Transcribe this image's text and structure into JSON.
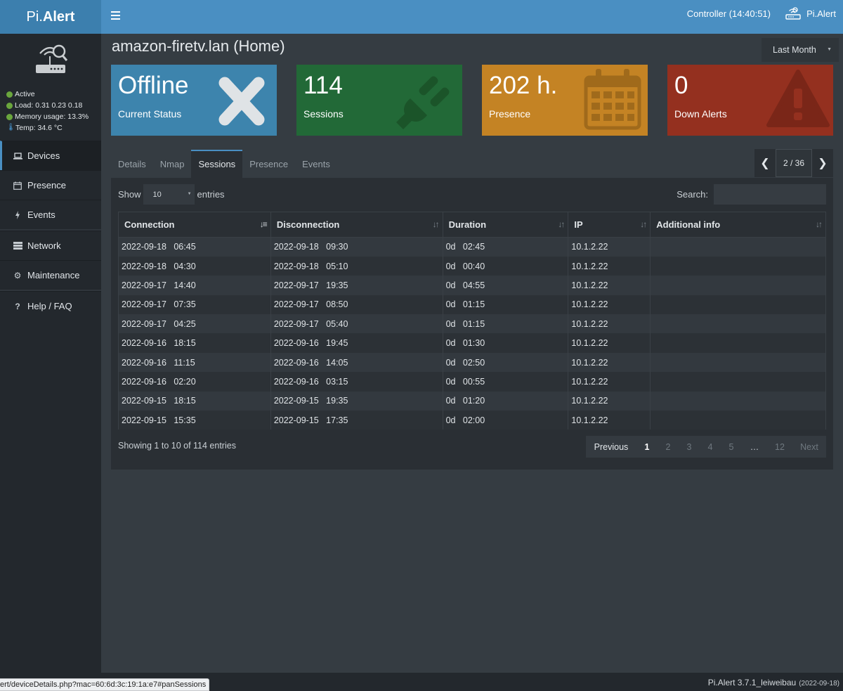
{
  "brand": {
    "light": "Pi.",
    "bold": "Alert"
  },
  "topbar": {
    "controller": "Controller (14:40:51)",
    "user": "Pi.Alert"
  },
  "sidebar": {
    "status": [
      {
        "label": "Active"
      },
      {
        "label": "Load:  0.31  0.23  0.18"
      },
      {
        "label": "Memory usage:  13.3%"
      },
      {
        "label": "Temp: 34.6 °C"
      }
    ],
    "nav": [
      {
        "label": "Devices",
        "icon": "laptop-icon"
      },
      {
        "label": "Presence",
        "icon": "calendar-icon"
      },
      {
        "label": "Events",
        "icon": "bolt-icon"
      },
      {
        "label": "Network",
        "icon": "server-icon"
      },
      {
        "label": "Maintenance",
        "icon": "gear-icon"
      },
      {
        "label": "Help / FAQ",
        "icon": "question-icon"
      }
    ]
  },
  "header": {
    "title": "amazon-firetv.lan (Home)",
    "range": "Last Month"
  },
  "boxes": [
    {
      "value": "Offline",
      "label": "Current Status",
      "icon": "close-icon",
      "color": "#3d84ad"
    },
    {
      "value": "114",
      "label": "Sessions",
      "icon": "plug-icon",
      "color": "#226937"
    },
    {
      "value": "202 h.",
      "label": "Presence",
      "icon": "calendar-icon",
      "color": "#c48324"
    },
    {
      "value": "0",
      "label": "Down Alerts",
      "icon": "warning-icon",
      "color": "#94301f"
    }
  ],
  "tabs": [
    "Details",
    "Nmap",
    "Sessions",
    "Presence",
    "Events"
  ],
  "device_pager": {
    "count": "2 / 36"
  },
  "table": {
    "show_label": "Show",
    "entries_label": "entries",
    "page_size": "10",
    "search_label": "Search:",
    "search_value": "",
    "columns": [
      "Connection",
      "Disconnection",
      "Duration",
      "IP",
      "Additional info"
    ],
    "rows": [
      [
        "2022-09-18   06:45",
        "2022-09-18   09:30",
        "0d   02:45",
        "10.1.2.22",
        ""
      ],
      [
        "2022-09-18   04:30",
        "2022-09-18   05:10",
        "0d   00:40",
        "10.1.2.22",
        ""
      ],
      [
        "2022-09-17   14:40",
        "2022-09-17   19:35",
        "0d   04:55",
        "10.1.2.22",
        ""
      ],
      [
        "2022-09-17   07:35",
        "2022-09-17   08:50",
        "0d   01:15",
        "10.1.2.22",
        ""
      ],
      [
        "2022-09-17   04:25",
        "2022-09-17   05:40",
        "0d   01:15",
        "10.1.2.22",
        ""
      ],
      [
        "2022-09-16   18:15",
        "2022-09-16   19:45",
        "0d   01:30",
        "10.1.2.22",
        ""
      ],
      [
        "2022-09-16   11:15",
        "2022-09-16   14:05",
        "0d   02:50",
        "10.1.2.22",
        ""
      ],
      [
        "2022-09-16   02:20",
        "2022-09-16   03:15",
        "0d   00:55",
        "10.1.2.22",
        ""
      ],
      [
        "2022-09-15   18:15",
        "2022-09-15   19:35",
        "0d   01:20",
        "10.1.2.22",
        ""
      ],
      [
        "2022-09-15   15:35",
        "2022-09-15   17:35",
        "0d   02:00",
        "10.1.2.22",
        ""
      ]
    ],
    "info": "Showing 1 to 10 of 114 entries",
    "pagination": [
      "Previous",
      "1",
      "2",
      "3",
      "4",
      "5",
      "…",
      "12",
      "Next"
    ]
  },
  "footer": {
    "version": "Pi.Alert  3.7.1_leiweibau",
    "date": "(2022-09-18)"
  },
  "status_url": "ert/deviceDetails.php?mac=60:6d:3c:19:1a:e7#panSessions"
}
